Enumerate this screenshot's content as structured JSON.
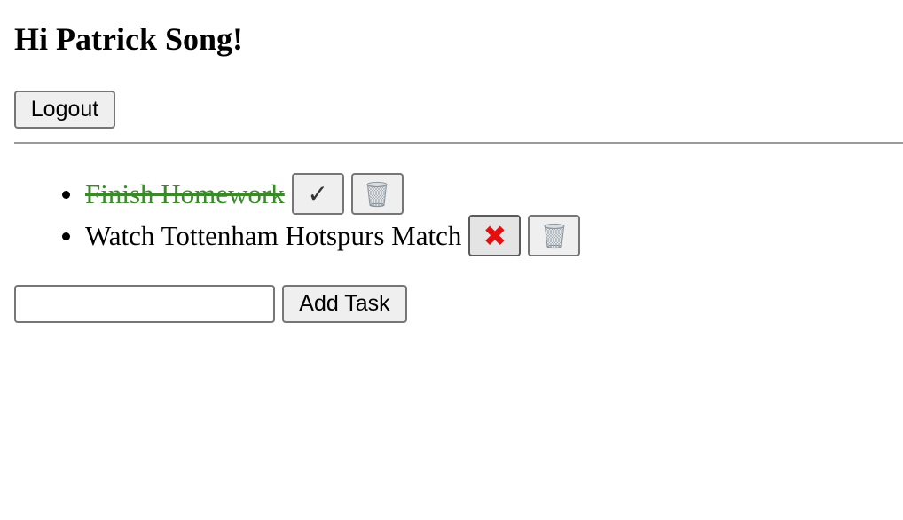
{
  "header": {
    "greeting": "Hi Patrick Song!"
  },
  "auth": {
    "logout_label": "Logout"
  },
  "tasks": [
    {
      "title": "Finish Homework",
      "completed": true,
      "toggle_icon": "check-icon",
      "delete_icon": "trash-icon"
    },
    {
      "title": "Watch Tottenham Hotspurs Match",
      "completed": false,
      "toggle_icon": "cross-icon",
      "delete_icon": "trash-icon"
    }
  ],
  "add_task": {
    "input_value": "",
    "input_placeholder": "",
    "button_label": "Add Task"
  },
  "colors": {
    "completed_text": "#3a8a2a",
    "cross_icon": "#e21111",
    "divider": "#9a9a9a"
  }
}
